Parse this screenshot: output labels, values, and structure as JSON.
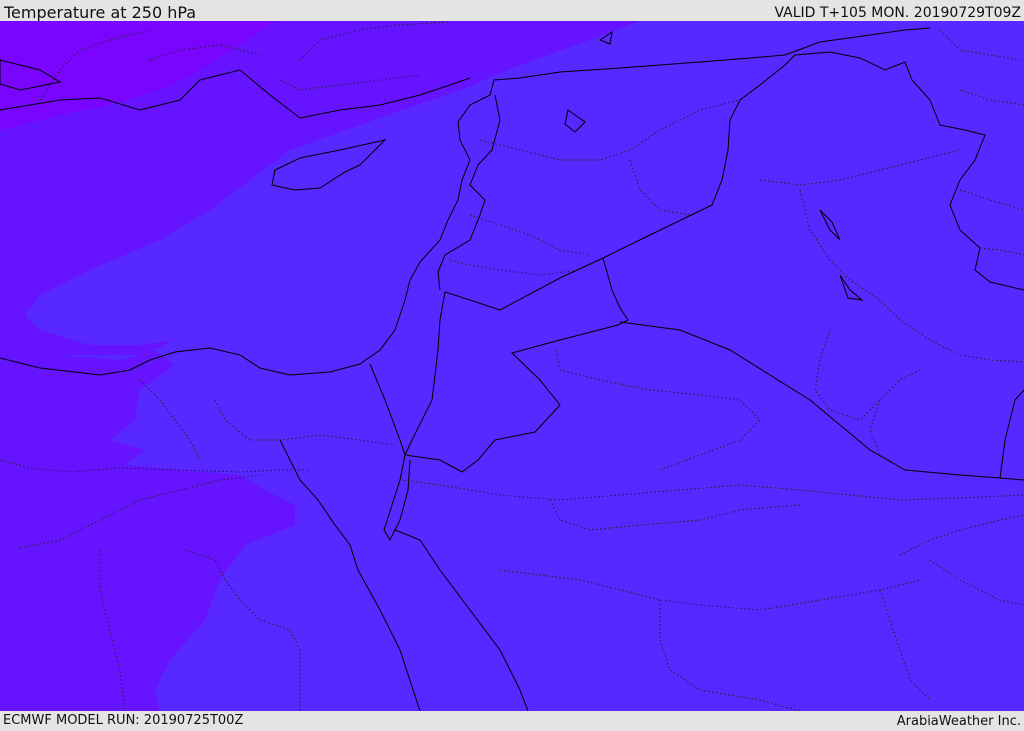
{
  "header": {
    "title": "Temperature at 250 hPa",
    "valid_time": "VALID T+105 MON. 20190729T09Z"
  },
  "footer": {
    "model_run": "ECMWF MODEL RUN: 20190725T00Z",
    "credit": "ArabiaWeather Inc."
  },
  "colors": {
    "main_field": "#5728ff",
    "mid_band": "#6614ff",
    "warm_band": "#7a05ff",
    "coastline": "#000000",
    "border": "#000000"
  }
}
